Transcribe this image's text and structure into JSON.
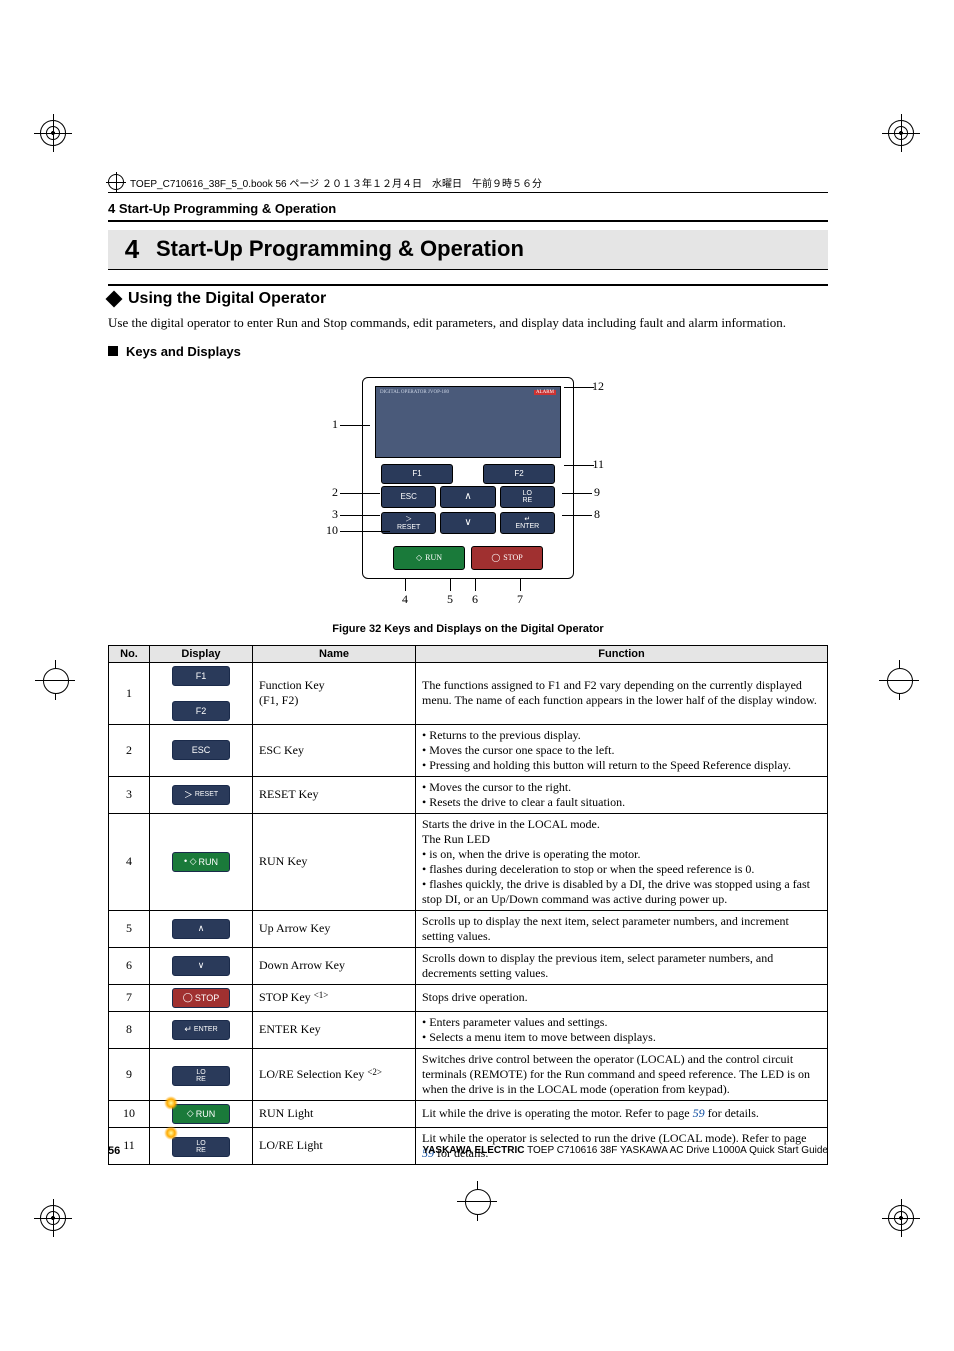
{
  "meta": {
    "bookline": "TOEP_C710616_38F_5_0.book  56 ページ  ２０１３年１２月４日　水曜日　午前９時５６分"
  },
  "headers": {
    "running": "4  Start-Up Programming & Operation",
    "chapter_num": "4",
    "chapter_title": "Start-Up Programming & Operation"
  },
  "sections": {
    "sub1": "Using the Digital Operator",
    "sub1_body": "Use the digital operator to enter Run and Stop commands, edit parameters, and display data including fault and alarm information.",
    "sub2": "Keys and Displays"
  },
  "figure": {
    "caption": "Figure 32  Keys and Displays on the Digital Operator",
    "lcd_left": "DIGITAL OPERATOR JVOP-180",
    "lcd_right": "ALARM",
    "keys": {
      "f1": "F1",
      "f2": "F2",
      "esc": "ESC",
      "reset": "RESET",
      "enter": "ENTER",
      "run": "RUN",
      "stop": "STOP",
      "lore": "LO/RE"
    },
    "callouts": {
      "c1": "1",
      "c2": "2",
      "c3": "3",
      "c4": "4",
      "c5": "5",
      "c6": "6",
      "c7": "7",
      "c8": "8",
      "c9": "9",
      "c10": "10",
      "c11": "11",
      "c12": "12"
    }
  },
  "table": {
    "headers": {
      "no": "No.",
      "display": "Display",
      "name": "Name",
      "function": "Function"
    },
    "rows": [
      {
        "no": "1",
        "name": "Function Key\n(F1, F2)",
        "function": "The functions assigned to F1 and F2 vary depending on the currently displayed menu. The name of each function appears in the lower half of the display window."
      },
      {
        "no": "2",
        "name": "ESC Key",
        "function": "• Returns to the previous display.\n• Moves the cursor one space to the left.\n• Pressing and holding this button will return to the Speed Reference display."
      },
      {
        "no": "3",
        "name": "RESET Key",
        "function": "• Moves the cursor to the right.\n• Resets the drive to clear a fault situation."
      },
      {
        "no": "4",
        "name": "RUN Key",
        "function": "Starts the drive in the LOCAL mode.\nThe Run LED\n• is on, when the drive is operating the motor.\n• flashes during deceleration to stop or when the speed reference is 0.\n• flashes quickly, the drive is disabled by a DI, the drive was stopped using a fast stop DI, or an Up/Down command was active during power up."
      },
      {
        "no": "5",
        "name": "Up Arrow Key",
        "function": "Scrolls up to display the next item, select parameter numbers, and increment setting values."
      },
      {
        "no": "6",
        "name": "Down Arrow Key",
        "function": "Scrolls down to display the previous item, select parameter numbers, and decrements setting values."
      },
      {
        "no": "7",
        "name": "STOP Key <1>",
        "function": "Stops drive operation."
      },
      {
        "no": "8",
        "name": "ENTER Key",
        "function": "• Enters parameter values and settings.\n• Selects a menu item to move between displays."
      },
      {
        "no": "9",
        "name": "LO/RE Selection Key <2>",
        "function": "Switches drive control between the operator (LOCAL) and the control circuit terminals (REMOTE) for the Run command and speed reference. The LED is on when the drive is in the LOCAL mode (operation from keypad)."
      },
      {
        "no": "10",
        "name": "RUN Light",
        "function_pre": "Lit while the drive is operating the motor. Refer to page ",
        "function_link": "59",
        "function_post": " for details."
      },
      {
        "no": "11",
        "name": "LO/RE Light",
        "function_pre": "Lit while the operator is selected to run the drive (LOCAL mode). Refer to page ",
        "function_link": "59",
        "function_post": " for details."
      }
    ]
  },
  "footer": {
    "page": "56",
    "company": "YASKAWA ELECTRIC",
    "doc": " TOEP C710616 38F YASKAWA AC Drive L1000A Quick Start Guide"
  }
}
